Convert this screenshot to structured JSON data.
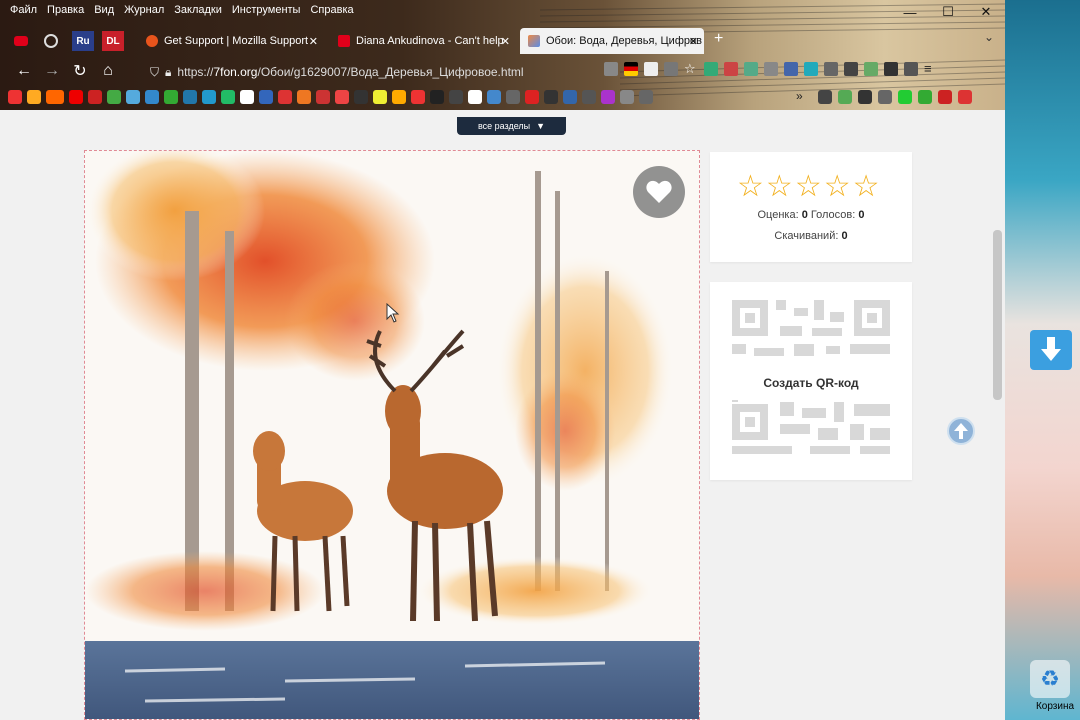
{
  "menu": [
    "Файл",
    "Правка",
    "Вид",
    "Журнал",
    "Закладки",
    "Инструменты",
    "Справка"
  ],
  "window_controls": {
    "minimize": "—",
    "maximize": "☐",
    "close": "✕"
  },
  "tabs": {
    "pinned": [
      "Ru",
      "DL"
    ],
    "items": [
      {
        "label": "Get Support | Mozilla Support",
        "fav_color": "#e8541c"
      },
      {
        "label": "Diana Ankudinova - Can't help",
        "fav_color": "#e0001a"
      },
      {
        "label": "Обои: Вода, Деревья, Цифров",
        "fav_color": "#5a8ee8"
      }
    ],
    "close": "✕",
    "new": "+"
  },
  "nav": {
    "url_prefix": "https://",
    "url_domain": "7fon.org",
    "url_path": "/Обои/g1629007/Вода_Деревья_Цифровое.html"
  },
  "page": {
    "sections_label": "все разделы",
    "rating": {
      "stars": 5,
      "score_label": "Оценка:",
      "score": "0",
      "votes_label": "Голосов:",
      "votes": "0",
      "downloads_label": "Скачиваний:",
      "downloads": "0"
    },
    "qr_button": "Создать QR-код"
  },
  "desktop": {
    "recycle_label": "Корзина"
  },
  "colors": {
    "star": "#f2b01e",
    "sections_bg": "#1d2b3e"
  }
}
